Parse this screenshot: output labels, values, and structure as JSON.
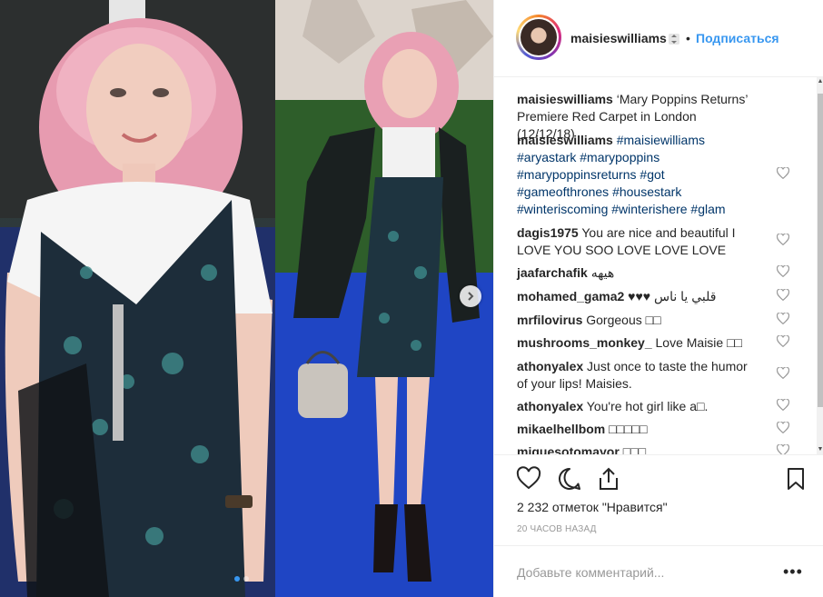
{
  "post": {
    "username": "maisieswilliams",
    "follow_label": "Подписаться",
    "separator": "•",
    "caption_user": "maisieswilliams",
    "caption_text": "‘Mary Poppins Returns’ Premiere Red Carpet in London (12/12/18)",
    "hashtag_comment_user": "maisieswilliams",
    "hashtags": [
      "#maisiewilliams",
      "#aryastark",
      "#marypoppins",
      "#marypoppinsreturns",
      "#got",
      "#gameofthrones",
      "#housestark",
      "#winteriscoming",
      "#winterishere",
      "#glam"
    ],
    "likes_text": "2 232 отметок \"Нравится\"",
    "time_text": "20 часов назад",
    "add_comment_placeholder": "Добавьте комментарий...",
    "more_label": "•••",
    "carousel_position": 1,
    "carousel_count": 2
  },
  "comments": [
    {
      "user": "dagis1975",
      "text": "You are nice and beautiful I LOVE YOU SOO LOVE LOVE LOVE"
    },
    {
      "user": "jaafarchafik",
      "text": "هيهه"
    },
    {
      "user": "mohamed_gama2",
      "text": "♥♥♥ قلبي يا ناس"
    },
    {
      "user": "mrfilovirus",
      "text": "Gorgeous □□"
    },
    {
      "user": "mushrooms_monkey_",
      "text": "Love Maisie □□"
    },
    {
      "user": "athonyalex",
      "text": "Just once to taste the humor of your lips! Maisies."
    },
    {
      "user": "athonyalex",
      "text": "You're hot girl like a□."
    },
    {
      "user": "mikaelhellbom",
      "text": "□□□□□"
    },
    {
      "user": "miguesotomayor",
      "text": "□□□"
    }
  ],
  "icons": {
    "verified": "verified-badge-icon",
    "like": "heart-icon",
    "comment": "comment-icon",
    "share": "share-icon",
    "save": "bookmark-icon",
    "next": "chevron-right-icon"
  },
  "colors": {
    "link": "#3897f0",
    "hashtag": "#003569",
    "text": "#262626",
    "muted": "#999999"
  }
}
